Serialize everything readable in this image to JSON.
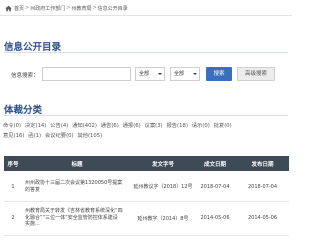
{
  "breadcrumb": {
    "items": [
      "首页",
      "州政府工作部门",
      "州教育局",
      "信息公开目录"
    ]
  },
  "directory": {
    "title": "信息公开目录"
  },
  "search": {
    "label": "信息搜索：",
    "input_value": "",
    "select1": "全部",
    "select2": "全部",
    "search_button": "搜索",
    "advanced_button": "高级搜索"
  },
  "categories": {
    "title": "体裁分类",
    "row1": [
      "命令(0)",
      "决定(14)",
      "公告(4)",
      "通知(402)",
      "通告(6)",
      "通报(6)",
      "议案(3)",
      "报告(18)",
      "请示(0)",
      "批复(0)"
    ],
    "row2": [
      "意见(16)",
      "函(1)",
      "会议纪要(0)",
      "其他(105)"
    ]
  },
  "table": {
    "headers": [
      "序号",
      "标题",
      "发文字号",
      "成文日期",
      "发布日期"
    ],
    "rows": [
      {
        "index": "1",
        "title_lines": [
          "州州政协十三届二次会议第1320050号提案",
          "的答复"
        ],
        "doc_no": "延州教议字〔2018〕12号",
        "written": "2018-07-04",
        "published": "2018-07-04"
      },
      {
        "index": "2",
        "title_lines": [
          "州教育局关于转发《吉林省教育系统深化“四",
          "化融合”“三位一体”安全监管防控体系建设",
          "实施..."
        ],
        "doc_no": "延州教字〔2014〕8号",
        "written": "2014-05-06",
        "published": "2014-05-06"
      }
    ]
  }
}
